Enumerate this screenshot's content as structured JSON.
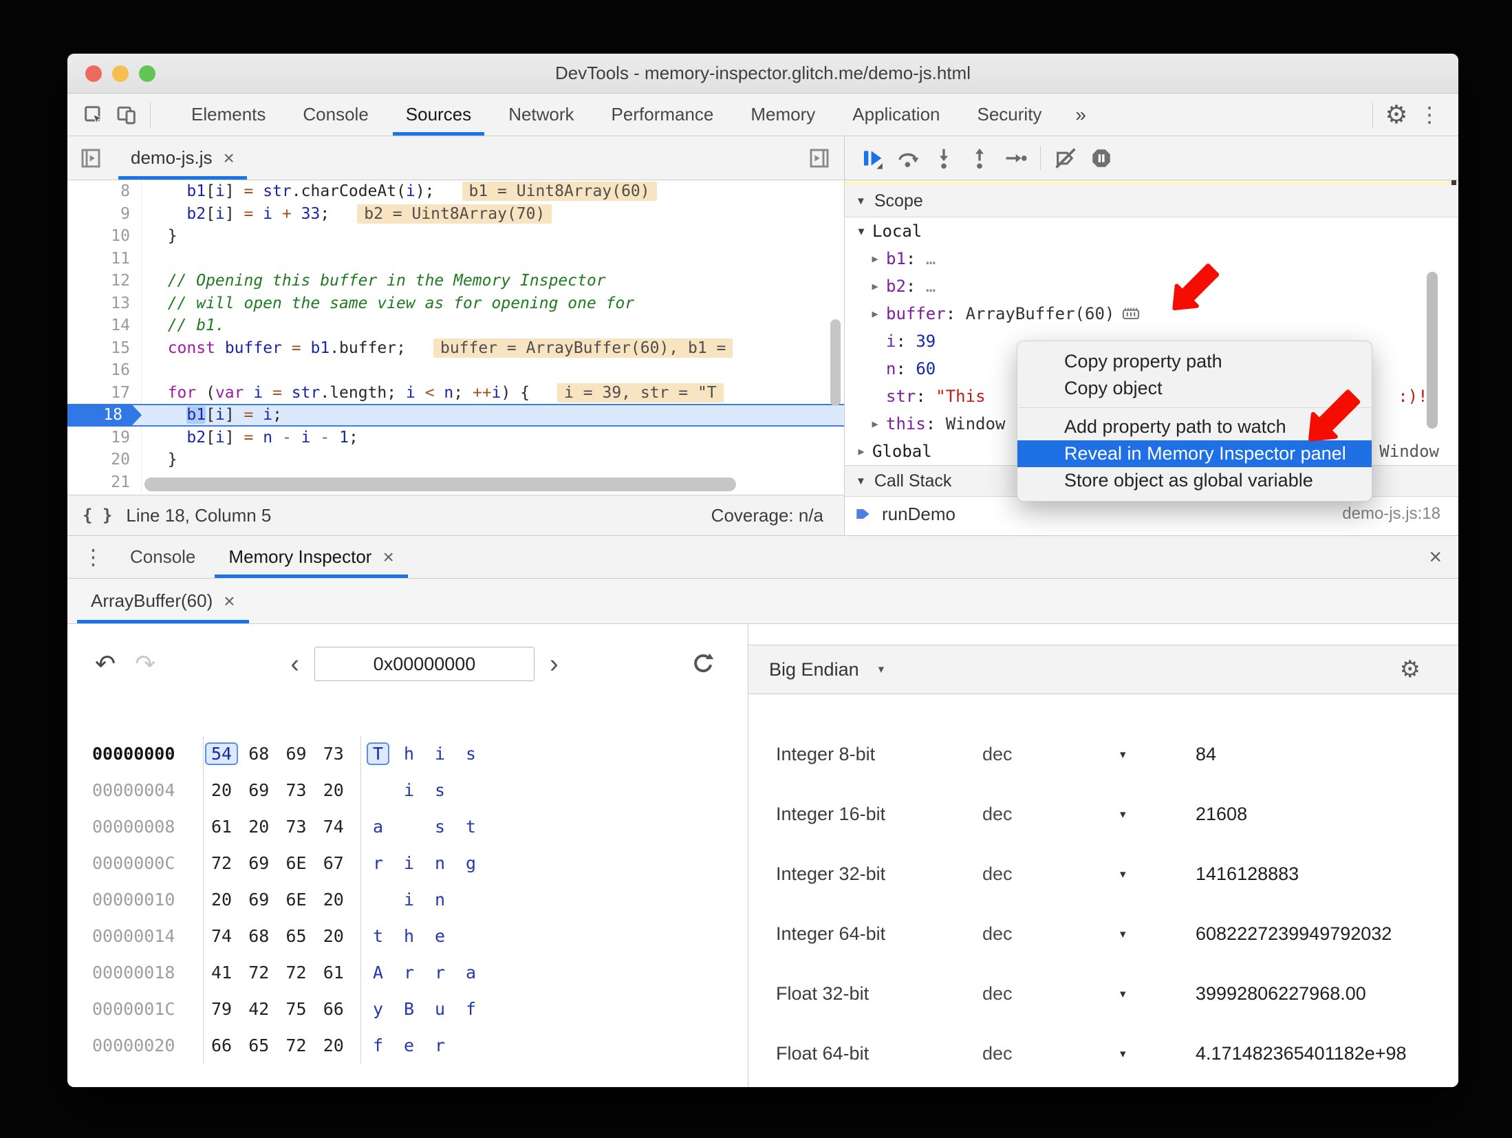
{
  "glyphs": {
    "gear": "⚙",
    "kebab": "⋮",
    "overflow": "»",
    "close": "×",
    "drawer_close": "×",
    "undo": "↶",
    "redo": "↷",
    "prev": "‹",
    "next": "›",
    "braces": "{ }",
    "expand": "▶",
    "collapse": "▼",
    "caret": "▾",
    "ellipsis": "…"
  },
  "window": {
    "title": "DevTools - memory-inspector.glitch.me/demo-js.html"
  },
  "main_toolbar": {
    "tabs": [
      "Elements",
      "Console",
      "Sources",
      "Network",
      "Performance",
      "Memory",
      "Application",
      "Security"
    ],
    "active_tab": "Sources",
    "overflow_label": "»"
  },
  "sources_panel": {
    "file_tab": {
      "label": "demo-js.js"
    },
    "editor": {
      "lines": [
        {
          "num": "8",
          "tokens": [
            [
              "    ",
              "p"
            ],
            [
              "b1",
              "v"
            ],
            [
              "[",
              "p"
            ],
            [
              "i",
              "v"
            ],
            [
              "] ",
              "p"
            ],
            [
              "=",
              "o"
            ],
            [
              " ",
              "p"
            ],
            [
              "str",
              "v"
            ],
            [
              ".charCodeAt(",
              "p"
            ],
            [
              "i",
              "v"
            ],
            [
              ");",
              "p"
            ]
          ],
          "hint": "b1 = Uint8Array(60)"
        },
        {
          "num": "9",
          "tokens": [
            [
              "    ",
              "p"
            ],
            [
              "b2",
              "v"
            ],
            [
              "[",
              "p"
            ],
            [
              "i",
              "v"
            ],
            [
              "] ",
              "p"
            ],
            [
              "=",
              "o"
            ],
            [
              " ",
              "p"
            ],
            [
              "i",
              "v"
            ],
            [
              " ",
              "p"
            ],
            [
              "+",
              "o"
            ],
            [
              " ",
              "p"
            ],
            [
              "33",
              "n"
            ],
            [
              ";",
              "p"
            ]
          ],
          "hint": "b2 = Uint8Array(70)"
        },
        {
          "num": "10",
          "tokens": [
            [
              "  }",
              "p"
            ]
          ]
        },
        {
          "num": "11",
          "tokens": []
        },
        {
          "num": "12",
          "tokens": [
            [
              "  // Opening this buffer in the Memory Inspector",
              "c"
            ]
          ]
        },
        {
          "num": "13",
          "tokens": [
            [
              "  // will open the same view as for opening one for",
              "c"
            ]
          ]
        },
        {
          "num": "14",
          "tokens": [
            [
              "  // b1.",
              "c"
            ]
          ]
        },
        {
          "num": "15",
          "tokens": [
            [
              "  ",
              "p"
            ],
            [
              "const",
              "k"
            ],
            [
              " ",
              "p"
            ],
            [
              "buffer",
              "v"
            ],
            [
              " ",
              "p"
            ],
            [
              "=",
              "o"
            ],
            [
              " ",
              "p"
            ],
            [
              "b1",
              "v"
            ],
            [
              ".buffer;",
              "p"
            ]
          ],
          "hint": "buffer = ArrayBuffer(60), b1 ="
        },
        {
          "num": "16",
          "tokens": []
        },
        {
          "num": "17",
          "tokens": [
            [
              "  ",
              "p"
            ],
            [
              "for",
              "k"
            ],
            [
              " (",
              "p"
            ],
            [
              "var",
              "k"
            ],
            [
              " ",
              "p"
            ],
            [
              "i",
              "v"
            ],
            [
              " ",
              "p"
            ],
            [
              "=",
              "o"
            ],
            [
              " ",
              "p"
            ],
            [
              "str",
              "v"
            ],
            [
              ".length; ",
              "p"
            ],
            [
              "i",
              "v"
            ],
            [
              " ",
              "p"
            ],
            [
              "<",
              "o"
            ],
            [
              " ",
              "p"
            ],
            [
              "n",
              "v"
            ],
            [
              "; ",
              "p"
            ],
            [
              "++",
              "o"
            ],
            [
              "i",
              "v"
            ],
            [
              ") {",
              "p"
            ]
          ],
          "hint": "i = 39, str = \"T"
        },
        {
          "num": "18",
          "exec": true,
          "tokens": [
            [
              "    ",
              "p"
            ],
            [
              "b1",
              "v sel"
            ],
            [
              "[",
              "p"
            ],
            [
              "i",
              "v"
            ],
            [
              "] ",
              "p"
            ],
            [
              "=",
              "o"
            ],
            [
              " ",
              "p"
            ],
            [
              "i",
              "v"
            ],
            [
              ";",
              "p"
            ]
          ]
        },
        {
          "num": "19",
          "tokens": [
            [
              "    ",
              "p"
            ],
            [
              "b2",
              "v"
            ],
            [
              "[",
              "p"
            ],
            [
              "i",
              "v"
            ],
            [
              "] ",
              "p"
            ],
            [
              "=",
              "o"
            ],
            [
              " ",
              "p"
            ],
            [
              "n",
              "v"
            ],
            [
              " ",
              "p"
            ],
            [
              "-",
              "o"
            ],
            [
              " ",
              "p"
            ],
            [
              "i",
              "v"
            ],
            [
              " ",
              "p"
            ],
            [
              "-",
              "o"
            ],
            [
              " ",
              "p"
            ],
            [
              "1",
              "n"
            ],
            [
              ";",
              "p"
            ]
          ]
        },
        {
          "num": "20",
          "tokens": [
            [
              "  }",
              "p"
            ]
          ]
        },
        {
          "num": "21",
          "tokens": []
        }
      ]
    },
    "status_bar": {
      "position": "Line 18, Column 5",
      "coverage": "Coverage: n/a"
    }
  },
  "debugger_pane": {
    "scope_title": "Scope",
    "call_stack_title": "Call Stack",
    "scope": {
      "local_label": "Local",
      "rows": [
        {
          "arrow": true,
          "name": "b1",
          "value": "…",
          "vcls": "dim"
        },
        {
          "arrow": true,
          "name": "b2",
          "value": "…",
          "vcls": "dim"
        },
        {
          "arrow": true,
          "name": "buffer",
          "value": "ArrayBuffer(60)",
          "vcls": "obj",
          "icon": "memory-chip"
        },
        {
          "arrow": false,
          "name": "i",
          "value": "39",
          "vcls": "num"
        },
        {
          "arrow": false,
          "name": "n",
          "value": "60",
          "vcls": "num"
        },
        {
          "arrow": false,
          "name": "str",
          "value": "\"This",
          "vcls": "str",
          "value_right": ":)!\""
        },
        {
          "arrow": true,
          "name": "this",
          "value": "Window",
          "vcls": "obj"
        }
      ],
      "global_row": {
        "label": "Global",
        "right": "Window"
      }
    },
    "call_stack": {
      "frames": [
        {
          "name": "runDemo",
          "location": "demo-js.js:18"
        }
      ]
    }
  },
  "context_menu": {
    "items": [
      {
        "label": "Copy property path"
      },
      {
        "label": "Copy object",
        "divider_after": true
      },
      {
        "label": "Add property path to watch"
      },
      {
        "label": "Reveal in Memory Inspector panel",
        "highlighted": true
      },
      {
        "label": "Store object as global variable"
      }
    ],
    "highlight_color": "#1f6fe5"
  },
  "drawer": {
    "tabs": [
      {
        "label": "Console"
      },
      {
        "label": "Memory Inspector",
        "closable": true,
        "active": true
      }
    ],
    "inspector_tabs": [
      {
        "label": "ArrayBuffer(60)",
        "closable": true,
        "active": true
      }
    ],
    "navigation": {
      "address": "0x00000000"
    },
    "hex_view": {
      "rows": [
        {
          "addr": "00000000",
          "bytes": [
            "54",
            "68",
            "69",
            "73"
          ],
          "ascii": [
            "T",
            "h",
            "i",
            "s"
          ],
          "current": true,
          "sel": 0
        },
        {
          "addr": "00000004",
          "bytes": [
            "20",
            "69",
            "73",
            "20"
          ],
          "ascii": [
            "",
            "i",
            "s",
            ""
          ]
        },
        {
          "addr": "00000008",
          "bytes": [
            "61",
            "20",
            "73",
            "74"
          ],
          "ascii": [
            "a",
            "",
            "s",
            "t"
          ]
        },
        {
          "addr": "0000000C",
          "bytes": [
            "72",
            "69",
            "6E",
            "67"
          ],
          "ascii": [
            "r",
            "i",
            "n",
            "g"
          ]
        },
        {
          "addr": "00000010",
          "bytes": [
            "20",
            "69",
            "6E",
            "20"
          ],
          "ascii": [
            "",
            "i",
            "n",
            ""
          ]
        },
        {
          "addr": "00000014",
          "bytes": [
            "74",
            "68",
            "65",
            "20"
          ],
          "ascii": [
            "t",
            "h",
            "e",
            ""
          ]
        },
        {
          "addr": "00000018",
          "bytes": [
            "41",
            "72",
            "72",
            "61"
          ],
          "ascii": [
            "A",
            "r",
            "r",
            "a"
          ]
        },
        {
          "addr": "0000001C",
          "bytes": [
            "79",
            "42",
            "75",
            "66"
          ],
          "ascii": [
            "y",
            "B",
            "u",
            "f"
          ]
        },
        {
          "addr": "00000020",
          "bytes": [
            "66",
            "65",
            "72",
            "20"
          ],
          "ascii": [
            "f",
            "e",
            "r",
            ""
          ]
        }
      ]
    },
    "interpreter": {
      "endianness": "Big Endian",
      "rows": [
        {
          "type": "Integer 8-bit",
          "radix": "dec",
          "value": "84"
        },
        {
          "type": "Integer 16-bit",
          "radix": "dec",
          "value": "21608"
        },
        {
          "type": "Integer 32-bit",
          "radix": "dec",
          "value": "1416128883"
        },
        {
          "type": "Integer 64-bit",
          "radix": "dec",
          "value": "6082227239949792032"
        },
        {
          "type": "Float 32-bit",
          "radix": "dec",
          "value": "39992806227968.00"
        },
        {
          "type": "Float 64-bit",
          "radix": "dec",
          "value": "4.171482365401182e+98"
        }
      ]
    }
  },
  "accent_colors": {
    "tab_underline": "#1a73e8",
    "execution_line": "#2f78e5",
    "annotation_arrow": "#f50d02"
  }
}
